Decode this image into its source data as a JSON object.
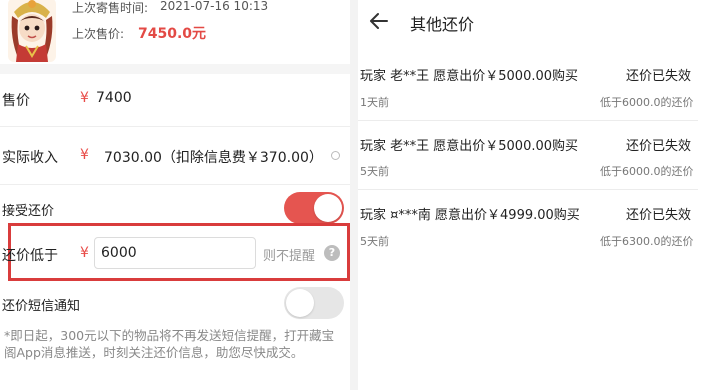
{
  "item": {
    "last_listing_label": "上次寄售时间:",
    "last_listing_time": "2021-07-16 10:13",
    "last_price_label": "上次售价:",
    "last_price": "7450.0元"
  },
  "price": {
    "label": "售价",
    "currency": "¥",
    "value": "7400"
  },
  "income": {
    "label": "实际收入",
    "currency": "¥",
    "value": "7030.00（扣除信息费￥370.00）"
  },
  "accept_offer": {
    "label": "接受还价",
    "enabled": true
  },
  "floor": {
    "label": "还价低于",
    "currency": "¥",
    "value": "6000",
    "ignore_label": "则不提醒",
    "help_glyph": "?"
  },
  "sms": {
    "label": "还价短信通知",
    "enabled": false
  },
  "notice": "*即日起，300元以下的物品将不再发送短信提醒，打开藏宝阁App消息推送，时刻关注还价信息，助您尽快成交。",
  "other_offers": {
    "title": "其他还价",
    "offers": [
      {
        "text": "玩家 老**王 愿意出价￥5000.00购买",
        "status": "还价已失效",
        "time": "1天前",
        "note": "低于6000.0的还价"
      },
      {
        "text": "玩家 老**王 愿意出价￥5000.00购买",
        "status": "还价已失效",
        "time": "5天前",
        "note": "低于6000.0的还价"
      },
      {
        "text": "玩家 ¤***南 愿意出价￥4999.00购买",
        "status": "还价已失效",
        "time": "5天前",
        "note": "低于6300.0的还价"
      }
    ]
  },
  "colors": {
    "accent_red": "#e84b47",
    "highlight_border": "#d93c3c",
    "toggle_on": "#e55550",
    "toggle_off": "#e6e6e6"
  },
  "icons": {
    "back": "arrow-left-icon",
    "help": "question-circle-icon",
    "info": "info-icon",
    "avatar": "character-avatar"
  }
}
